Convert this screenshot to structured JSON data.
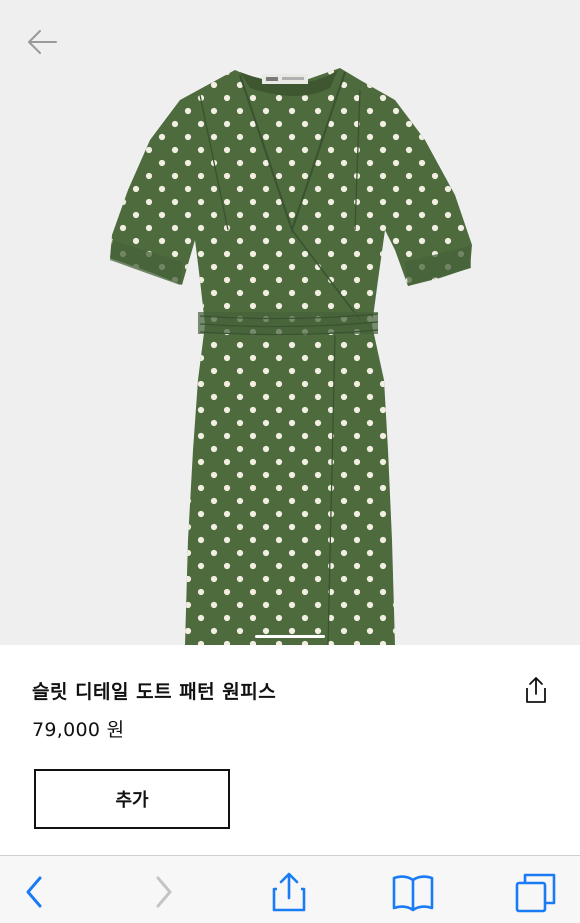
{
  "product": {
    "name": "슬릿 디테일 도트 패턴 원피스",
    "price": "79,000 원",
    "add_label": "추가",
    "dress_color": "#4e6b3e",
    "dot_color": "#f2efe2",
    "background_color": "#efeff0"
  },
  "icons": {
    "back": "back-arrow-icon",
    "share": "share-icon",
    "toolbar_back": "chevron-left-icon",
    "toolbar_forward": "chevron-right-icon",
    "toolbar_share": "share-icon",
    "toolbar_bookmarks": "book-icon",
    "toolbar_tabs": "tabs-icon"
  },
  "colors": {
    "toolbar_accent": "#1a7cf5",
    "toolbar_disabled": "#c4c4c6",
    "text": "#111111"
  }
}
